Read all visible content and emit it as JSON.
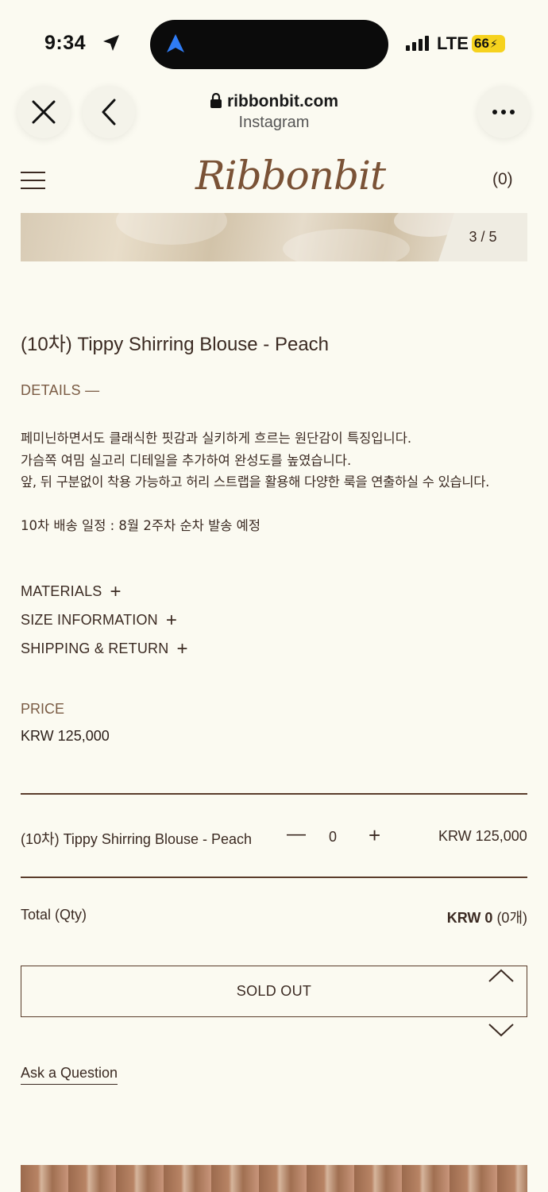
{
  "status_bar": {
    "time": "9:34",
    "network": "LTE",
    "battery": "66"
  },
  "browser": {
    "domain": "ribbonbit.com",
    "source": "Instagram"
  },
  "header": {
    "logo": "Ribbonbit",
    "cart_count": "(0)"
  },
  "gallery": {
    "counter": "3 / 5"
  },
  "product": {
    "title": "(10차) Tippy Shirring Blouse - Peach",
    "details_label": "DETAILS —",
    "description": [
      "페미닌하면서도 클래식한 핏감과 실키하게 흐르는 원단감이 특징입니다.",
      "가슴쪽 여밈 실고리 디테일을 추가하여 완성도를 높였습니다.",
      "앞, 뒤 구분없이 착용 가능하고 허리 스트랩을 활용해 다양한 룩을 연출하실 수 있습니다."
    ],
    "shipping_note": "10차 배송 일정 : 8월 2주차 순차 발송 예정",
    "accordions": [
      "MATERIALS",
      "SIZE INFORMATION",
      "SHIPPING & RETURN"
    ],
    "accordion_plus": "+",
    "price_label": "PRICE",
    "price": "KRW 125,000"
  },
  "option": {
    "name": "(10차) Tippy Shirring Blouse - Peach",
    "minus": "—",
    "qty": "0",
    "plus": "+",
    "price": "KRW 125,000"
  },
  "total": {
    "label": "Total (Qty)",
    "amount": "KRW 0",
    "qty": "(0개)"
  },
  "actions": {
    "sold_out": "SOLD OUT",
    "ask": "Ask a Question"
  }
}
